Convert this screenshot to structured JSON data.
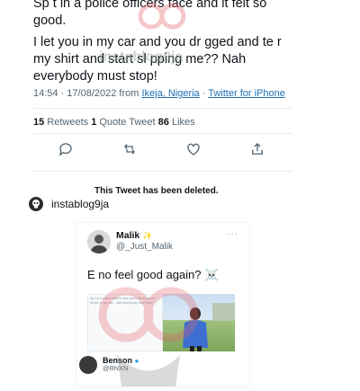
{
  "tweet": {
    "line1": "Sp t in a police officers face and it felt so",
    "line2": "good.",
    "line3": "I let you in my car and you dr gged and te r",
    "line4": "my shirt and start sl pping me?? Nah",
    "line5": "everybody must stop!",
    "time": "14:54 · 17/08/2022 from ",
    "location": "Ikeja, Nigeria",
    "sep": " · ",
    "client": "Twitter for iPhone",
    "retweets_count": "15",
    "retweets_label": " Retweets ",
    "quotes_count": "1",
    "quotes_label": " Quote Tweet ",
    "likes_count": "86",
    "likes_label": " Likes"
  },
  "deleted_notice": "This Tweet has been deleted.",
  "instagram": {
    "username": "instablog9ja"
  },
  "quoted": {
    "name": "Malik",
    "handle": "@_Just_Malik",
    "menu": "···",
    "text": "E no feel good again? ☠️",
    "embed_text": "Sp t in a police officers face and it felt so good. I let you in my car... Nah everybody must stop!",
    "reply_name": "Benson",
    "reply_handle": "@BNXN"
  },
  "watermark": "instablog9ja",
  "colors": {
    "link": "#1d6fb3",
    "icon": "#536471"
  }
}
